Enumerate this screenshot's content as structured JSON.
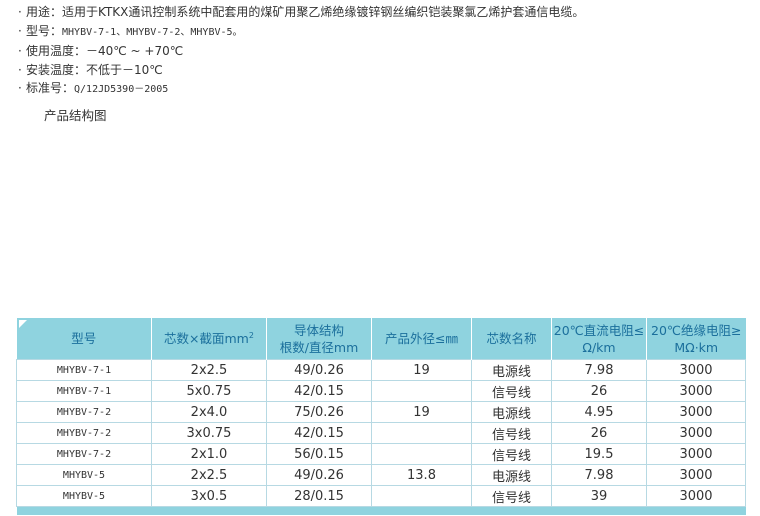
{
  "specs": {
    "usage": "用途：适用于KTKX通讯控制系统中配套用的煤矿用聚乙烯绝缘镀锌钢丝编织铠装聚氯乙烯护套通信电缆。",
    "model_label": "型号：",
    "model_value": "MHYBV-7-1、MHYBV-7-2、MHYBV-5。",
    "temp_use": "使用温度：－40℃ ~ +70℃",
    "temp_install": "安装温度：不低于－10℃",
    "standard_label": "标准号：",
    "standard_value": "Q/12JD5390－2005"
  },
  "diagram_caption": "产品结构图",
  "table": {
    "headers": {
      "model": "型号",
      "cores_text": "芯数×截面mm",
      "cores_sup": "2",
      "conductor_line1": "导体结构",
      "conductor_line2": "根数/直径mm",
      "diameter": "产品外径≤㎜",
      "core_name": "芯数名称",
      "resistance_line1": "20℃直流电阻≤",
      "resistance_line2": "Ω/km",
      "insulation_line1": "20℃绝缘电阻≥",
      "insulation_line2": "MΩ·km"
    },
    "rows": [
      {
        "model": "MHYBV-7-1",
        "cores": "2x2.5",
        "conductor": "49/0.26",
        "diameter": "19",
        "name": "电源线",
        "resistance": "7.98",
        "insulation": "3000"
      },
      {
        "model": "MHYBV-7-1",
        "cores": "5x0.75",
        "conductor": "42/0.15",
        "diameter": "",
        "name": "信号线",
        "resistance": "26",
        "insulation": "3000"
      },
      {
        "model": "MHYBV-7-2",
        "cores": "2x4.0",
        "conductor": "75/0.26",
        "diameter": "19",
        "name": "电源线",
        "resistance": "4.95",
        "insulation": "3000"
      },
      {
        "model": "MHYBV-7-2",
        "cores": "3x0.75",
        "conductor": "42/0.15",
        "diameter": "",
        "name": "信号线",
        "resistance": "26",
        "insulation": "3000"
      },
      {
        "model": "MHYBV-7-2",
        "cores": "2x1.0",
        "conductor": "56/0.15",
        "diameter": "",
        "name": "信号线",
        "resistance": "19.5",
        "insulation": "3000"
      },
      {
        "model": "MHYBV-5",
        "cores": "2x2.5",
        "conductor": "49/0.26",
        "diameter": "13.8",
        "name": "电源线",
        "resistance": "7.98",
        "insulation": "3000"
      },
      {
        "model": "MHYBV-5",
        "cores": "3x0.5",
        "conductor": "28/0.15",
        "diameter": "",
        "name": "信号线",
        "resistance": "39",
        "insulation": "3000"
      }
    ]
  },
  "colors": {
    "header_bg": "#8fd3df",
    "header_text": "#1b6f9c",
    "border": "#b7d9e3"
  }
}
